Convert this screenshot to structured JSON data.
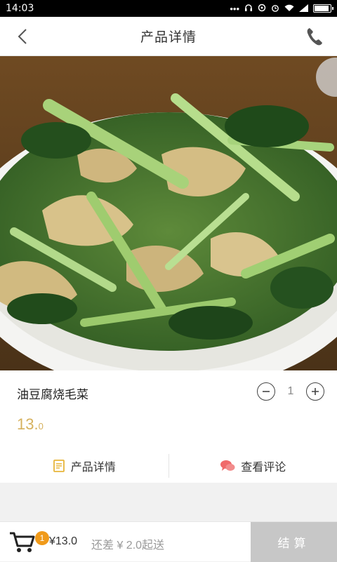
{
  "status": {
    "time": "14:03",
    "indicators": [
      "dots-icon",
      "headset-icon",
      "sync-icon",
      "alarm-icon",
      "wifi-icon",
      "signal-icon",
      "battery-icon"
    ]
  },
  "nav": {
    "title": "产品详情",
    "back_icon": "chevron-left-icon",
    "phone_icon": "phone-icon"
  },
  "product": {
    "name": "油豆腐烧毛菜",
    "quantity": "1",
    "price_main": "13.",
    "price_decimal": "0"
  },
  "tabs": [
    {
      "label": "产品详情",
      "icon": "document-icon",
      "color": "#e7b53a"
    },
    {
      "label": "查看评论",
      "icon": "comment-icon",
      "color": "#f06a6a"
    }
  ],
  "cart": {
    "badge": "1",
    "total": "¥13.0",
    "shortfall": "还差 ¥ 2.0起送",
    "checkout_label": "结算"
  }
}
